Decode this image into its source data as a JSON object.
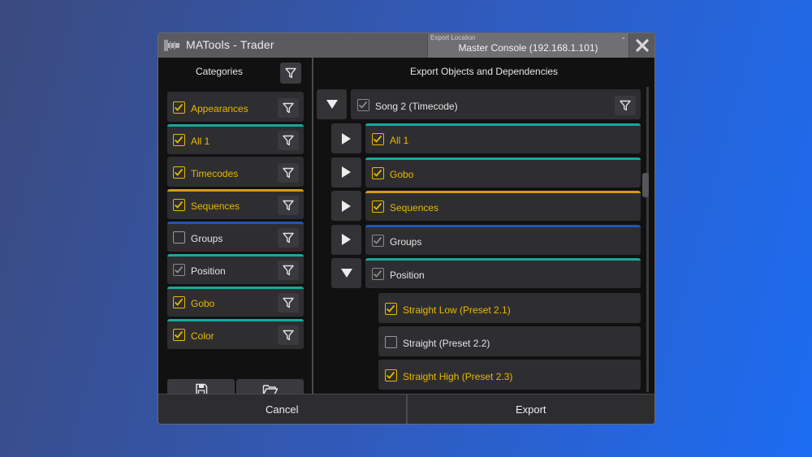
{
  "window": {
    "title": "MATools - Trader",
    "export_location_label": "Export Location",
    "export_location_value": "Master Console (192.168.1.101)"
  },
  "left_panel": {
    "title": "Categories",
    "items": [
      {
        "label": "Appearances",
        "checked": true,
        "check_color": "#e8b800",
        "text_color": "#e8b800",
        "accent": ""
      },
      {
        "label": "All 1",
        "checked": true,
        "check_color": "#e8b800",
        "text_color": "#e8b800",
        "accent": "#18a89a"
      },
      {
        "label": "Timecodes",
        "checked": true,
        "check_color": "#e8b800",
        "text_color": "#e8b800",
        "accent": ""
      },
      {
        "label": "Sequences",
        "checked": true,
        "check_color": "#e8b800",
        "text_color": "#e8b800",
        "accent": "#d69a1a"
      },
      {
        "label": "Groups",
        "checked": false,
        "check_color": "#9a9a9a",
        "text_color": "#e4e4e4",
        "accent": "#1f57b8"
      },
      {
        "label": "Position",
        "checked": true,
        "check_color": "#8a8a8a",
        "text_color": "#e4e4e4",
        "accent": "#18a89a"
      },
      {
        "label": "Gobo",
        "checked": true,
        "check_color": "#e8b800",
        "text_color": "#e8b800",
        "accent": "#18a89a"
      },
      {
        "label": "Color",
        "checked": true,
        "check_color": "#e8b800",
        "text_color": "#e8b800",
        "accent": "#18a89a"
      }
    ]
  },
  "right_panel": {
    "title": "Export Objects and Dependencies",
    "root": {
      "label": "Song 2 (Timecode)",
      "checked": true,
      "check_color": "#8a8a8a",
      "text_color": "#e4e4e4"
    },
    "children": [
      {
        "label": "All 1",
        "checked": true,
        "check_color": "#e8b800",
        "text_color": "#e8b800",
        "accent": "#18a89a",
        "expanded": false
      },
      {
        "label": "Gobo",
        "checked": true,
        "check_color": "#e8b800",
        "text_color": "#e8b800",
        "accent": "#18a89a",
        "expanded": false
      },
      {
        "label": "Sequences",
        "checked": true,
        "check_color": "#e8b800",
        "text_color": "#e8b800",
        "accent": "#d69a1a",
        "expanded": false
      },
      {
        "label": "Groups",
        "checked": true,
        "check_color": "#8a8a8a",
        "text_color": "#e4e4e4",
        "accent": "#1f57b8",
        "expanded": false
      },
      {
        "label": "Position",
        "checked": true,
        "check_color": "#8a8a8a",
        "text_color": "#e4e4e4",
        "accent": "#18a89a",
        "expanded": true
      }
    ],
    "presets": [
      {
        "label": "Straight Low (Preset 2.1)",
        "checked": true,
        "check_color": "#e8b800",
        "text_color": "#e8b800"
      },
      {
        "label": "Straight (Preset 2.2)",
        "checked": false,
        "check_color": "#9a9a9a",
        "text_color": "#e4e4e4"
      },
      {
        "label": "Straight High (Preset 2.3)",
        "checked": true,
        "check_color": "#e8b800",
        "text_color": "#e8b800"
      }
    ]
  },
  "footer": {
    "cancel_label": "Cancel",
    "export_label": "Export"
  }
}
